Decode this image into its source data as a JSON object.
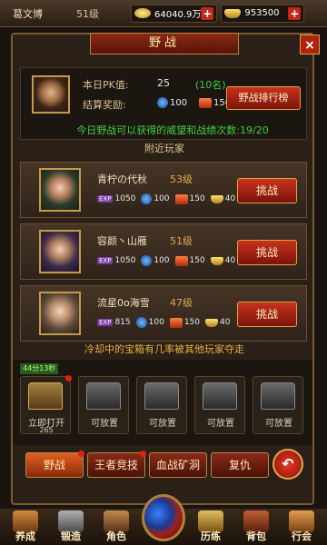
{
  "topbar": {
    "player_name": "葛文博",
    "player_level": "51级",
    "silver": "64040.9万",
    "gold": "953500",
    "plus": "+"
  },
  "panel": {
    "title": "野战",
    "close": "×",
    "pk_label": "本日PK值:",
    "pk_value": "25",
    "pk_extra": "(10名)",
    "reward_label": "结算奖励:",
    "reward_orb": "100",
    "reward_badge": "150",
    "rank_button": "野战排行榜",
    "green_notice": "今日野战可以获得的威望和战绩次数:19/20",
    "section_title": "附近玩家",
    "orange_notice": "冷却中的宝箱有几率被其他玩家夺走"
  },
  "opponents": [
    {
      "name": "青柠の代秋",
      "level": "53级",
      "exp": "1050",
      "orb": "100",
      "badge": "150",
      "ingot": "40",
      "button": "挑战"
    },
    {
      "name": "容颜丶山雁",
      "level": "51级",
      "exp": "1050",
      "orb": "100",
      "badge": "150",
      "ingot": "40",
      "button": "挑战"
    },
    {
      "name": "流星0o海雪",
      "level": "47级",
      "exp": "815",
      "orb": "100",
      "badge": "150",
      "ingot": "40",
      "button": "挑战"
    }
  ],
  "chests": {
    "timer": "44分13秒",
    "slots": [
      {
        "label": "立即打开",
        "sub": "265"
      },
      {
        "label": "可放置"
      },
      {
        "label": "可放置"
      },
      {
        "label": "可放置"
      },
      {
        "label": "可放置"
      }
    ]
  },
  "tabs": [
    "野战",
    "王者竞技",
    "血战矿洞",
    "复仇"
  ],
  "back_button": "↶",
  "bottom_nav": [
    "养成",
    "锻造",
    "角色",
    "历练",
    "背包",
    "行会"
  ]
}
